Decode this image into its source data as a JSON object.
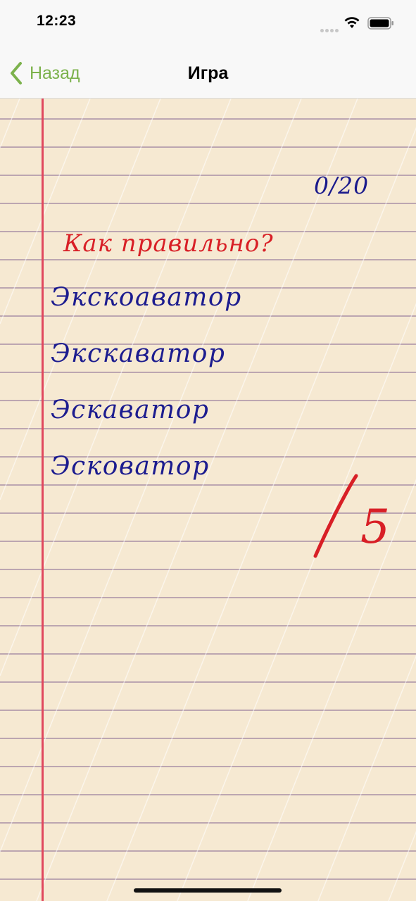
{
  "status_bar": {
    "time": "12:23",
    "icons": [
      "cellular-signal-icon",
      "wifi-icon",
      "battery-icon"
    ]
  },
  "nav": {
    "back_label": "Назад",
    "back_icon": "chevron-left-icon",
    "title": "Игра"
  },
  "game": {
    "score": "0/20",
    "question": "Как правильно?",
    "options": [
      "Экскоаватор",
      "Экскаватор",
      "Эскаватор",
      "Эсковатор"
    ],
    "grade": "5"
  },
  "colors": {
    "accent": "#7cb24c",
    "paper": "#f6e9d2",
    "margin_line": "#e0485e",
    "ink_blue": "#1c1c8f",
    "ink_red": "#d81f26"
  }
}
